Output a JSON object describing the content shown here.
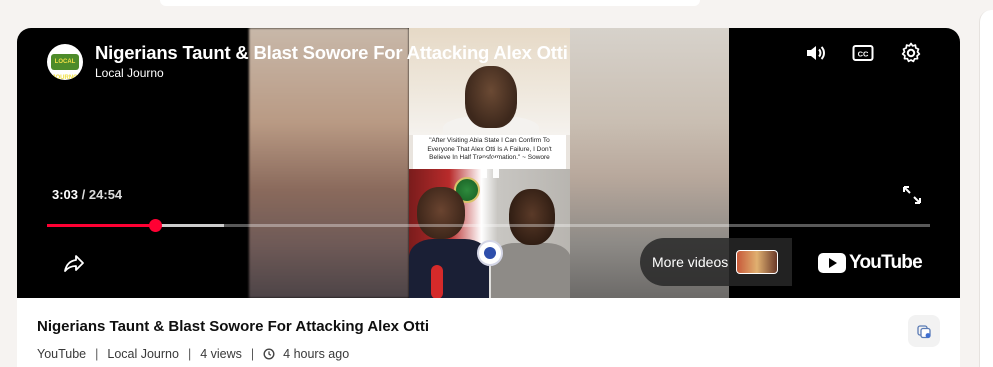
{
  "player": {
    "title": "Nigerians Taunt & Blast Sowore For Attacking Alex Otti",
    "channel": "Local Journo",
    "channel_logo_text": "LOCAL JOURNO",
    "current_time": "3:03",
    "time_separator": "/",
    "duration": "24:54",
    "progress_fraction": 0.122,
    "buffer_fraction": 0.2,
    "thumbnail_quote": "\"After Visiting Abia State I Can Confirm To Everyone That Alex Otti Is A Failure, I Don't Believe In Half Transformation.\" ~ Sowore",
    "more_videos_label": "More videos",
    "brand_label": "YouTube",
    "accent_color": "#ff0033"
  },
  "info": {
    "title": "Nigerians Taunt & Blast Sowore For Attacking Alex Otti",
    "source": "YouTube",
    "channel": "Local Journo",
    "views": "4 views",
    "age": "4 hours ago",
    "separator": "|"
  }
}
